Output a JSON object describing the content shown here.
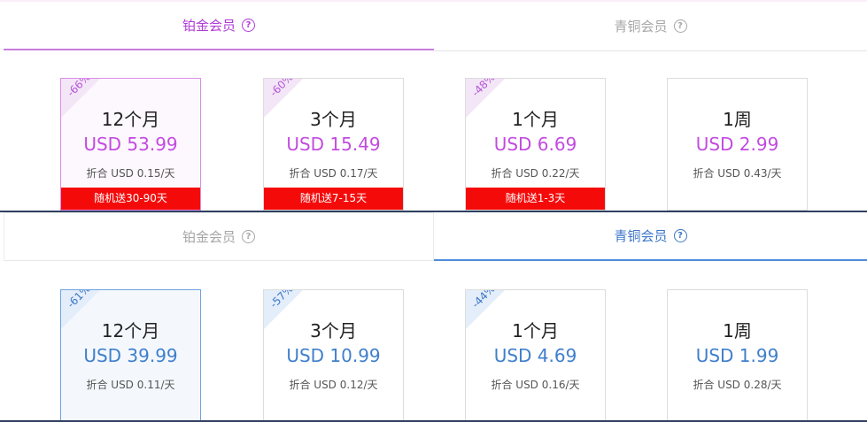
{
  "panel1": {
    "tabs": [
      {
        "label": "铂金会员",
        "active": true
      },
      {
        "label": "青铜会员",
        "active": false
      }
    ],
    "plans": [
      {
        "discount": "-66%",
        "period": "12个月",
        "price": "USD 53.99",
        "per_day": "折合 USD 0.15/天",
        "bonus": "随机送30-90天",
        "selected": true
      },
      {
        "discount": "-60%",
        "period": "3个月",
        "price": "USD 15.49",
        "per_day": "折合 USD 0.17/天",
        "bonus": "随机送7-15天",
        "selected": false
      },
      {
        "discount": "-48%",
        "period": "1个月",
        "price": "USD 6.69",
        "per_day": "折合 USD 0.22/天",
        "bonus": "随机送1-3天",
        "selected": false
      },
      {
        "discount": "",
        "period": "1周",
        "price": "USD 2.99",
        "per_day": "折合 USD 0.43/天",
        "bonus": "",
        "selected": false
      }
    ]
  },
  "panel2": {
    "tabs": [
      {
        "label": "铂金会员",
        "active": false
      },
      {
        "label": "青铜会员",
        "active": true
      }
    ],
    "plans": [
      {
        "discount": "-61%",
        "period": "12个月",
        "price": "USD 39.99",
        "per_day": "折合 USD 0.11/天",
        "selected": true
      },
      {
        "discount": "-57%",
        "period": "3个月",
        "price": "USD 10.99",
        "per_day": "折合 USD 0.12/天",
        "selected": false
      },
      {
        "discount": "-44%",
        "period": "1个月",
        "price": "USD 4.69",
        "per_day": "折合 USD 0.16/天",
        "selected": false
      },
      {
        "discount": "",
        "period": "1周",
        "price": "USD 1.99",
        "per_day": "折合 USD 0.28/天",
        "selected": false
      }
    ]
  },
  "icons": {
    "help": "help-circle-icon"
  },
  "colors": {
    "platinum_accent": "#c24be0",
    "bronze_accent": "#3f7fcc",
    "bonus_red": "#f50a0a"
  }
}
